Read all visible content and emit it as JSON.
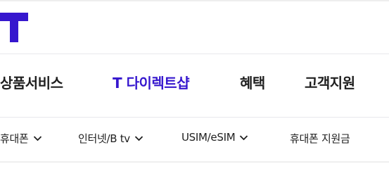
{
  "brand": {
    "accent_color": "#3617ce"
  },
  "gnb": {
    "items": [
      {
        "label": "상품서비스",
        "active": false
      },
      {
        "label": "T 다이렉트샵",
        "active": true
      },
      {
        "label": "혜택",
        "active": false
      },
      {
        "label": "고객지원",
        "active": false
      }
    ]
  },
  "subnav": {
    "items": [
      {
        "label": "휴대폰",
        "icon": "chevron-down-icon"
      },
      {
        "label": "인터넷/B tv",
        "icon": "chevron-down-icon"
      },
      {
        "label": "USIM/eSIM",
        "icon": "chevron-down-icon"
      },
      {
        "label": "휴대폰 지원금"
      }
    ]
  }
}
